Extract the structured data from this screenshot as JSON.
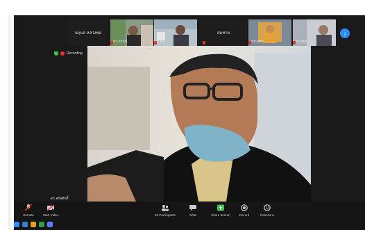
{
  "participants_strip": [
    {
      "name": "นฤมล หลวงพ่อ",
      "type": "name-only"
    },
    {
      "name": "ดร.ต่วนนี",
      "type": "video"
    },
    {
      "name": "ตำบล",
      "type": "video"
    },
    {
      "name": "สมชาย",
      "type": "name-only"
    },
    {
      "name": "หลวงพ่อ",
      "type": "video"
    },
    {
      "name": "ดร.สมร",
      "type": "video"
    }
  ],
  "recording_label": "Recording",
  "active_speaker_name": "ดร.จรัสศักดิ์",
  "toolbar": {
    "unmute": "Unmute",
    "start_video": "Start Video",
    "participants": "Participants",
    "participants_count": "24",
    "chat": "Chat",
    "share_screen": "Share Screen",
    "record": "Record",
    "reactions": "Reactions"
  },
  "colors": {
    "accent": "#2d8cff",
    "share": "#3bbf4d",
    "recording": "#e33333"
  }
}
